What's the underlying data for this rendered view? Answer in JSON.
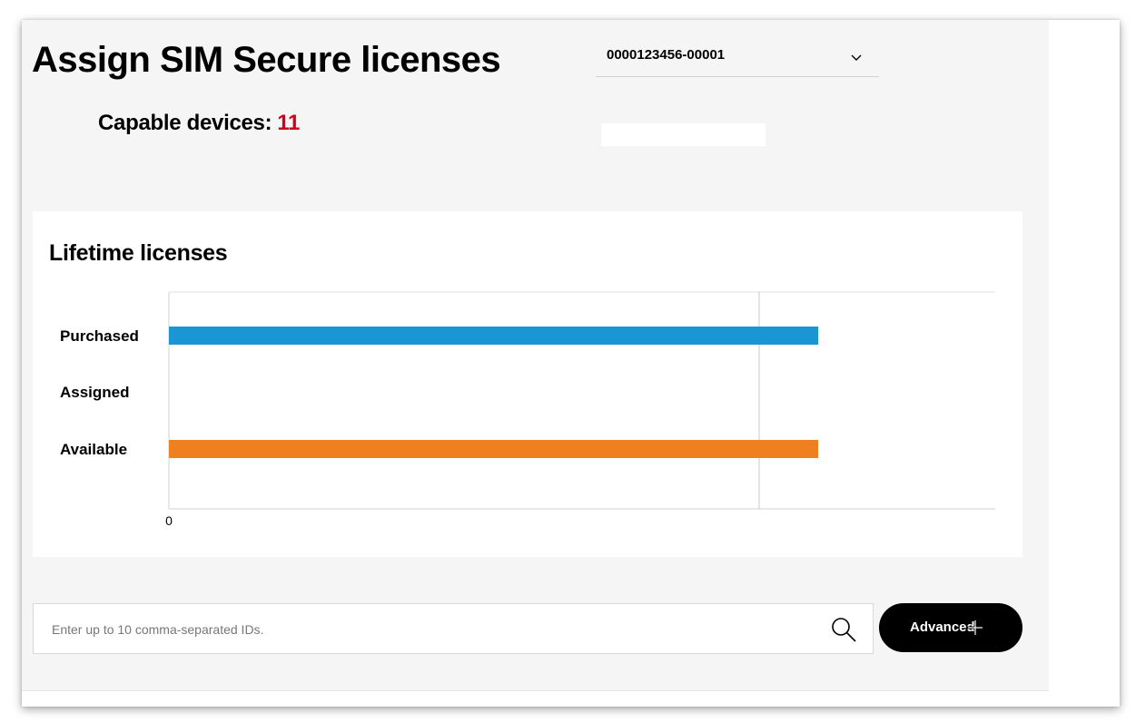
{
  "page": {
    "title": "Assign SIM Secure licenses"
  },
  "account_select": {
    "value": "0000123456-00001",
    "icon": "chevron-down-icon"
  },
  "capable_devices": {
    "label": "Capable devices:",
    "count": "11",
    "count_color": "#d0021b"
  },
  "licenses_card": {
    "title": "Lifetime licenses"
  },
  "chart_data": {
    "type": "bar",
    "orientation": "horizontal",
    "title": "Lifetime licenses",
    "categories": [
      "Purchased",
      "Assigned",
      "Available"
    ],
    "values": [
      11,
      0,
      11
    ],
    "colors": [
      "#1a96d4",
      "#1a96d4",
      "#f0801f"
    ],
    "x_tick_labels": [
      "0"
    ],
    "xlim": [
      0,
      14
    ],
    "grid": true,
    "legend": "none"
  },
  "search": {
    "placeholder": "Enter up to 10 comma-separated IDs.",
    "value": "",
    "icon": "search-icon"
  },
  "advanced_button": {
    "label": "Advanced"
  },
  "colors": {
    "purchased_bar": "#1a96d4",
    "available_bar": "#f0801f",
    "button_bg": "#000000",
    "page_bg": "#f5f5f5"
  }
}
